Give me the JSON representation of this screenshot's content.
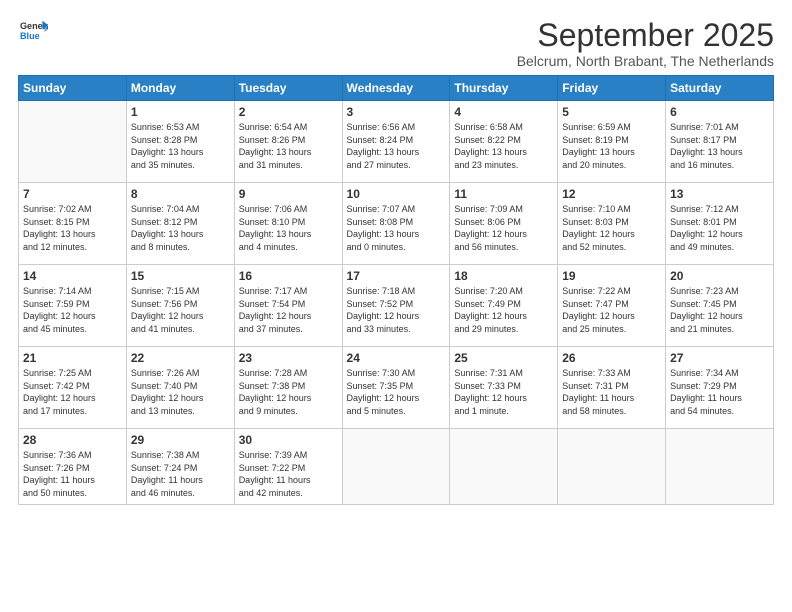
{
  "header": {
    "logo_line1": "General",
    "logo_line2": "Blue",
    "month": "September 2025",
    "location": "Belcrum, North Brabant, The Netherlands"
  },
  "days_of_week": [
    "Sunday",
    "Monday",
    "Tuesday",
    "Wednesday",
    "Thursday",
    "Friday",
    "Saturday"
  ],
  "weeks": [
    [
      {
        "day": "",
        "info": ""
      },
      {
        "day": "1",
        "info": "Sunrise: 6:53 AM\nSunset: 8:28 PM\nDaylight: 13 hours\nand 35 minutes."
      },
      {
        "day": "2",
        "info": "Sunrise: 6:54 AM\nSunset: 8:26 PM\nDaylight: 13 hours\nand 31 minutes."
      },
      {
        "day": "3",
        "info": "Sunrise: 6:56 AM\nSunset: 8:24 PM\nDaylight: 13 hours\nand 27 minutes."
      },
      {
        "day": "4",
        "info": "Sunrise: 6:58 AM\nSunset: 8:22 PM\nDaylight: 13 hours\nand 23 minutes."
      },
      {
        "day": "5",
        "info": "Sunrise: 6:59 AM\nSunset: 8:19 PM\nDaylight: 13 hours\nand 20 minutes."
      },
      {
        "day": "6",
        "info": "Sunrise: 7:01 AM\nSunset: 8:17 PM\nDaylight: 13 hours\nand 16 minutes."
      }
    ],
    [
      {
        "day": "7",
        "info": "Sunrise: 7:02 AM\nSunset: 8:15 PM\nDaylight: 13 hours\nand 12 minutes."
      },
      {
        "day": "8",
        "info": "Sunrise: 7:04 AM\nSunset: 8:12 PM\nDaylight: 13 hours\nand 8 minutes."
      },
      {
        "day": "9",
        "info": "Sunrise: 7:06 AM\nSunset: 8:10 PM\nDaylight: 13 hours\nand 4 minutes."
      },
      {
        "day": "10",
        "info": "Sunrise: 7:07 AM\nSunset: 8:08 PM\nDaylight: 13 hours\nand 0 minutes."
      },
      {
        "day": "11",
        "info": "Sunrise: 7:09 AM\nSunset: 8:06 PM\nDaylight: 12 hours\nand 56 minutes."
      },
      {
        "day": "12",
        "info": "Sunrise: 7:10 AM\nSunset: 8:03 PM\nDaylight: 12 hours\nand 52 minutes."
      },
      {
        "day": "13",
        "info": "Sunrise: 7:12 AM\nSunset: 8:01 PM\nDaylight: 12 hours\nand 49 minutes."
      }
    ],
    [
      {
        "day": "14",
        "info": "Sunrise: 7:14 AM\nSunset: 7:59 PM\nDaylight: 12 hours\nand 45 minutes."
      },
      {
        "day": "15",
        "info": "Sunrise: 7:15 AM\nSunset: 7:56 PM\nDaylight: 12 hours\nand 41 minutes."
      },
      {
        "day": "16",
        "info": "Sunrise: 7:17 AM\nSunset: 7:54 PM\nDaylight: 12 hours\nand 37 minutes."
      },
      {
        "day": "17",
        "info": "Sunrise: 7:18 AM\nSunset: 7:52 PM\nDaylight: 12 hours\nand 33 minutes."
      },
      {
        "day": "18",
        "info": "Sunrise: 7:20 AM\nSunset: 7:49 PM\nDaylight: 12 hours\nand 29 minutes."
      },
      {
        "day": "19",
        "info": "Sunrise: 7:22 AM\nSunset: 7:47 PM\nDaylight: 12 hours\nand 25 minutes."
      },
      {
        "day": "20",
        "info": "Sunrise: 7:23 AM\nSunset: 7:45 PM\nDaylight: 12 hours\nand 21 minutes."
      }
    ],
    [
      {
        "day": "21",
        "info": "Sunrise: 7:25 AM\nSunset: 7:42 PM\nDaylight: 12 hours\nand 17 minutes."
      },
      {
        "day": "22",
        "info": "Sunrise: 7:26 AM\nSunset: 7:40 PM\nDaylight: 12 hours\nand 13 minutes."
      },
      {
        "day": "23",
        "info": "Sunrise: 7:28 AM\nSunset: 7:38 PM\nDaylight: 12 hours\nand 9 minutes."
      },
      {
        "day": "24",
        "info": "Sunrise: 7:30 AM\nSunset: 7:35 PM\nDaylight: 12 hours\nand 5 minutes."
      },
      {
        "day": "25",
        "info": "Sunrise: 7:31 AM\nSunset: 7:33 PM\nDaylight: 12 hours\nand 1 minute."
      },
      {
        "day": "26",
        "info": "Sunrise: 7:33 AM\nSunset: 7:31 PM\nDaylight: 11 hours\nand 58 minutes."
      },
      {
        "day": "27",
        "info": "Sunrise: 7:34 AM\nSunset: 7:29 PM\nDaylight: 11 hours\nand 54 minutes."
      }
    ],
    [
      {
        "day": "28",
        "info": "Sunrise: 7:36 AM\nSunset: 7:26 PM\nDaylight: 11 hours\nand 50 minutes."
      },
      {
        "day": "29",
        "info": "Sunrise: 7:38 AM\nSunset: 7:24 PM\nDaylight: 11 hours\nand 46 minutes."
      },
      {
        "day": "30",
        "info": "Sunrise: 7:39 AM\nSunset: 7:22 PM\nDaylight: 11 hours\nand 42 minutes."
      },
      {
        "day": "",
        "info": ""
      },
      {
        "day": "",
        "info": ""
      },
      {
        "day": "",
        "info": ""
      },
      {
        "day": "",
        "info": ""
      }
    ]
  ]
}
